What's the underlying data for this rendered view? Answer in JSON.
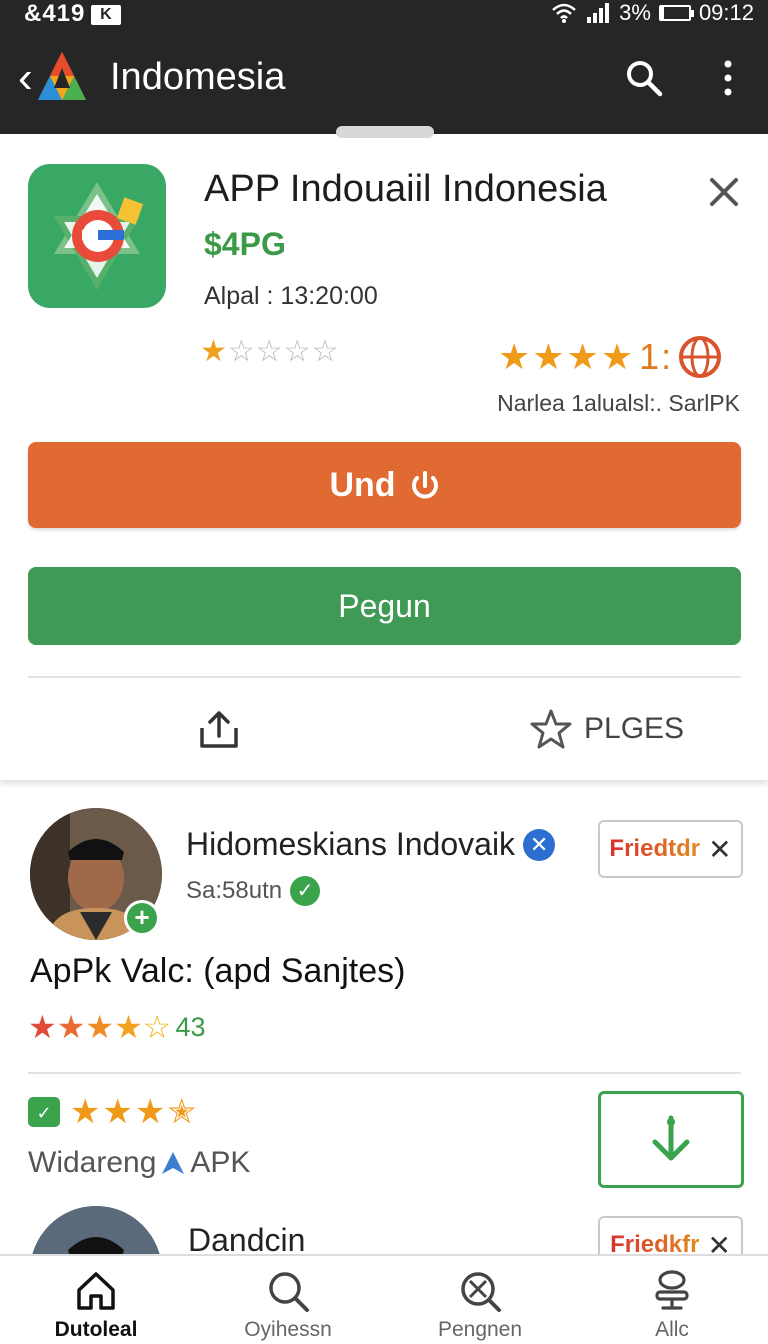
{
  "status_bar": {
    "left_text": "&419",
    "left_box": "K",
    "battery": "3%",
    "time": "09:12"
  },
  "app_bar": {
    "title": "Indomesia",
    "icons": [
      "back-arrow-icon",
      "app-logo",
      "search-icon",
      "more-vert-icon"
    ]
  },
  "app_card": {
    "name": "APP Indouaiil Indonesia",
    "price": "$4PG",
    "meta": "Alpal : 13:20:00",
    "user_rating_stars": 1,
    "stars_right_count": 4,
    "rating_number": "1:",
    "rating_caption": "Narlea 1alualsl:. SarlPK",
    "primary_button": "Und",
    "secondary_button": "Pegun",
    "plges_label": "PLGES",
    "colors": {
      "primary": "#e06a32",
      "secondary": "#3f9a55",
      "accent_green": "#3a9a47",
      "star": "#f09a1a"
    }
  },
  "reviews": [
    {
      "name": "Hidomeskians Indovaik",
      "subtitle": "Sa:58utn",
      "friend_label": "Friedtdr",
      "title": "ApPk Valc: (apd Sanjtes)",
      "rating": 4.5,
      "count": "43"
    },
    {
      "rating": 3.5,
      "label": "Widareng",
      "label_suffix": "APK"
    },
    {
      "name": "Dandcin",
      "friend_label": "Friedkfr"
    }
  ],
  "bottom_nav": [
    {
      "label": "Dutoleal",
      "icon": "home-icon",
      "active": true
    },
    {
      "label": "Oyihessn",
      "icon": "search-icon",
      "active": false
    },
    {
      "label": "Pengnen",
      "icon": "explore-icon",
      "active": false
    },
    {
      "label": "Allc",
      "icon": "profile-stack-icon",
      "active": false
    }
  ]
}
